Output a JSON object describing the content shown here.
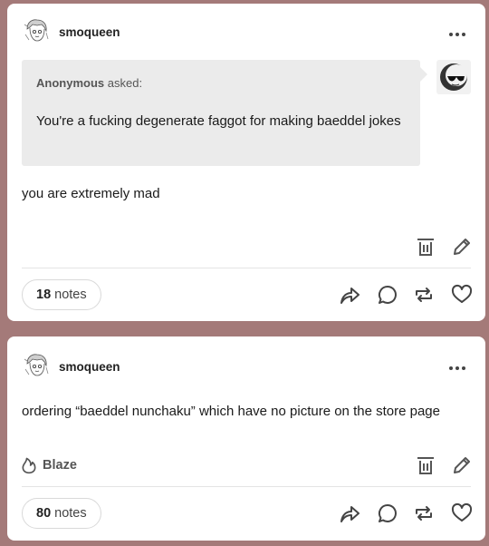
{
  "posts": [
    {
      "username": "smoqueen",
      "ask": {
        "asker": "Anonymous",
        "asked_label": "asked:",
        "question": "You're a fucking degenerate faggot for making baeddel jokes"
      },
      "body": "you are extremely mad",
      "notes_count": "18",
      "notes_label": "notes",
      "icons": [
        "delete-icon",
        "edit-icon",
        "share-icon",
        "reply-icon",
        "reblog-icon",
        "like-icon"
      ]
    },
    {
      "username": "smoqueen",
      "body": "ordering “baeddel nunchaku” which have no picture on the store page",
      "blaze_label": "Blaze",
      "notes_count": "80",
      "notes_label": "notes",
      "icons": [
        "delete-icon",
        "edit-icon",
        "share-icon",
        "reply-icon",
        "reblog-icon",
        "like-icon"
      ]
    }
  ]
}
